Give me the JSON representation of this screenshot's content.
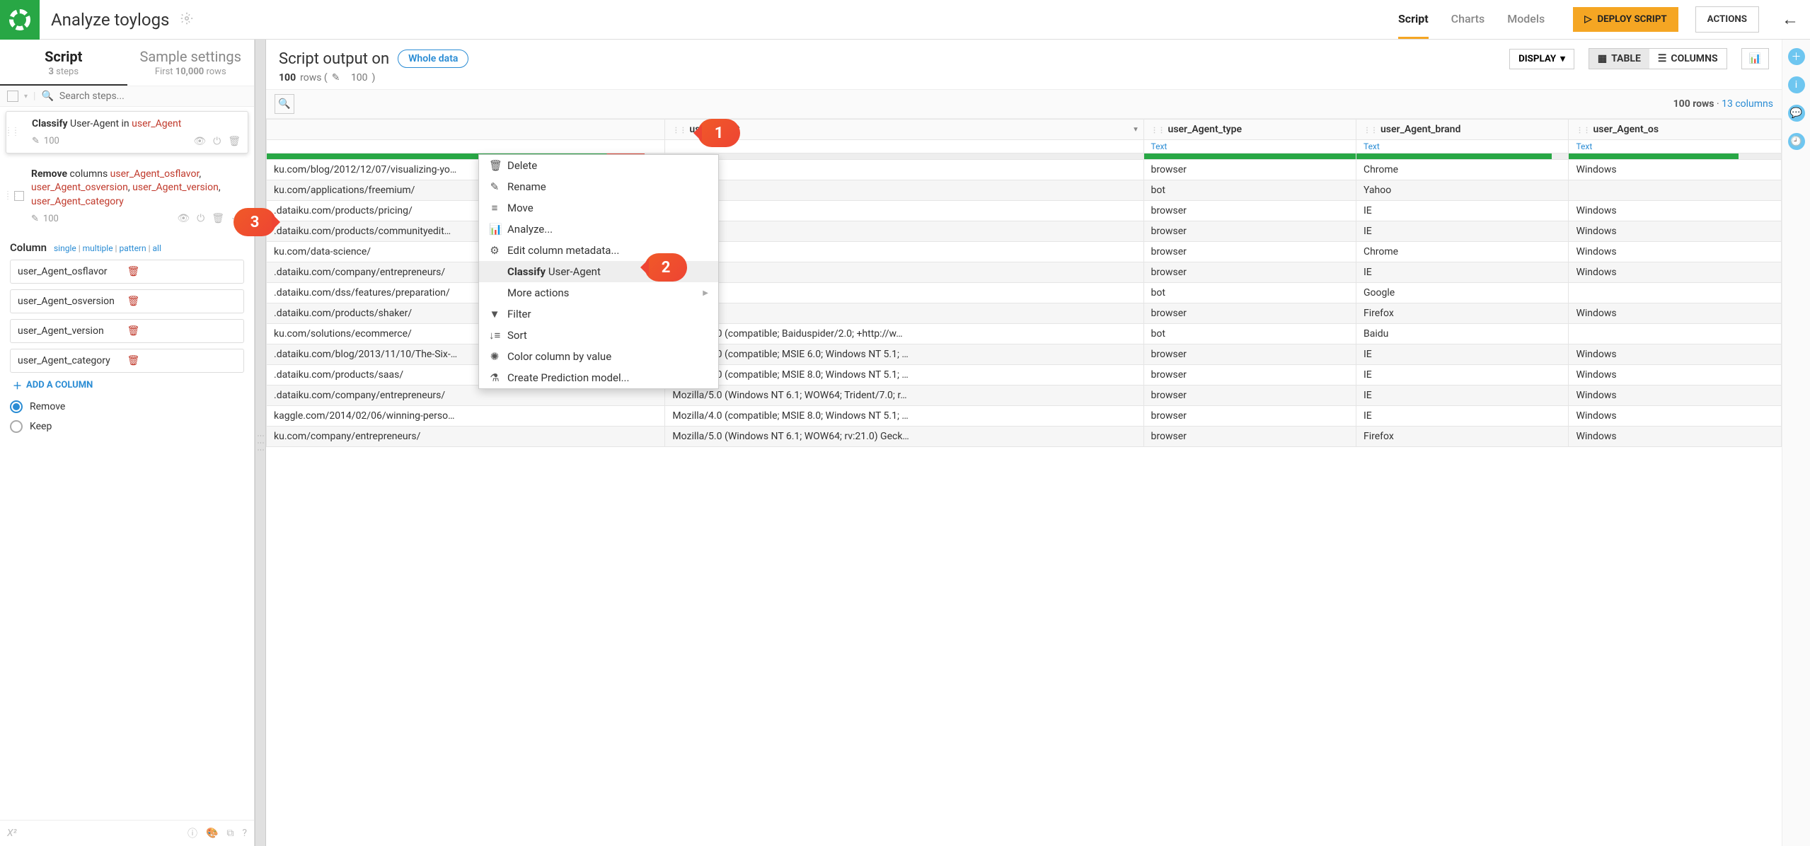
{
  "header": {
    "title": "Analyze toylogs",
    "tabs": [
      "Script",
      "Charts",
      "Models"
    ],
    "active_tab": 0,
    "deploy": "DEPLOY SCRIPT",
    "actions": "ACTIONS"
  },
  "left_panel": {
    "tabs": [
      {
        "title": "Script",
        "sub_pre": "3",
        "sub_post": " steps"
      },
      {
        "title": "Sample settings",
        "sub_pre": "First ",
        "sub_mid": "10,000",
        "sub_post": " rows"
      }
    ],
    "active_tab": 0,
    "search_placeholder": "Search steps...",
    "steps": [
      {
        "text_parts": [
          "Classify",
          " User-Agent in ",
          "user_Agent"
        ],
        "count": "100"
      },
      {
        "text_parts": [
          "Remove",
          " columns ",
          "user_Agent_osflavor",
          ", ",
          "user_Agent_osversion",
          ", ",
          "user_Agent_version",
          ", ",
          "user_Agent_category"
        ],
        "count": "100"
      }
    ],
    "params": {
      "label": "Column",
      "links": [
        "single",
        "multiple",
        "pattern",
        "all"
      ],
      "columns": [
        "user_Agent_osflavor",
        "user_Agent_osversion",
        "user_Agent_version",
        "user_Agent_category"
      ],
      "add": "ADD A COLUMN",
      "radios": [
        "Remove",
        "Keep"
      ],
      "radio_selected": 0
    }
  },
  "output": {
    "title": "Script output on",
    "whole_data": "Whole data",
    "rows_label_pre": "100",
    "rows_label_post": " rows  ( ",
    "rows_edit": "100",
    "rows_label_end": " )",
    "display": "DISPLAY",
    "table": "TABLE",
    "columns_btn": "COLUMNS",
    "info_rows": "100 rows",
    "info_cols": "13 columns",
    "table_cols": [
      {
        "name": "",
        "type": ""
      },
      {
        "name": "user_Agent",
        "type": ""
      },
      {
        "name": "user_Agent_type",
        "type": "Text"
      },
      {
        "name": "user_Agent_brand",
        "type": "Text"
      },
      {
        "name": "user_Agent_os",
        "type": "Text"
      }
    ],
    "bar_widths": [
      "95%",
      "0%",
      "100%",
      "92%",
      "80%"
    ],
    "rows": [
      [
        "ku.com/blog/2012/12/07/visualizing-yo…",
        "",
        "browser",
        "Chrome",
        "Windows"
      ],
      [
        "ku.com/applications/freemium/",
        "",
        "bot",
        "Yahoo",
        ""
      ],
      [
        ".dataiku.com/products/pricing/",
        "",
        "browser",
        "IE",
        "Windows"
      ],
      [
        ".dataiku.com/products/communityedit…",
        "",
        "browser",
        "IE",
        "Windows"
      ],
      [
        "ku.com/data-science/",
        "",
        "browser",
        "Chrome",
        "Windows"
      ],
      [
        ".dataiku.com/company/entrepreneurs/",
        "",
        "browser",
        "IE",
        "Windows"
      ],
      [
        ".dataiku.com/dss/features/preparation/",
        "",
        "bot",
        "Google",
        ""
      ],
      [
        ".dataiku.com/products/shaker/",
        "",
        "browser",
        "Firefox",
        "Windows"
      ],
      [
        "ku.com/solutions/ecommerce/",
        "Mozilla/5.0 (compatible; Baiduspider/2.0; +http://w…",
        "bot",
        "Baidu",
        ""
      ],
      [
        ".dataiku.com/blog/2013/11/10/The-Six-…",
        "Mozilla/4.0 (compatible; MSIE 6.0; Windows NT 5.1; …",
        "browser",
        "IE",
        "Windows"
      ],
      [
        ".dataiku.com/products/saas/",
        "Mozilla/4.0 (compatible; MSIE 8.0; Windows NT 5.1; …",
        "browser",
        "IE",
        "Windows"
      ],
      [
        ".dataiku.com/company/entrepreneurs/",
        "Mozilla/5.0 (Windows NT 6.1; WOW64; Trident/7.0; r…",
        "browser",
        "IE",
        "Windows"
      ],
      [
        "kaggle.com/2014/02/06/winning-perso…",
        "Mozilla/4.0 (compatible; MSIE 8.0; Windows NT 5.1; …",
        "browser",
        "IE",
        "Windows"
      ],
      [
        "ku.com/company/entrepreneurs/",
        "Mozilla/5.0 (Windows NT 6.1; WOW64; rv:21.0) Geck…",
        "browser",
        "Firefox",
        "Windows"
      ]
    ]
  },
  "ctx_menu": {
    "items": [
      {
        "icon": "🗑",
        "label": "Delete"
      },
      {
        "icon": "✎",
        "label": "Rename"
      },
      {
        "icon": "≡",
        "label": "Move"
      },
      {
        "icon": "📊",
        "label": "Analyze..."
      },
      {
        "icon": "⚙",
        "label": "Edit column metadata..."
      },
      {
        "icon": "",
        "label_pre": "Classify",
        "label_post": " User-Agent",
        "bold": true,
        "selected": true
      },
      {
        "icon": "",
        "label": "More actions",
        "arrow": true
      },
      {
        "icon": "▼",
        "label": "Filter",
        "funnel": true
      },
      {
        "icon": "↓≡",
        "label": "Sort"
      },
      {
        "icon": "✺",
        "label": "Color column by value"
      },
      {
        "icon": "⚗",
        "label": "Create Prediction model..."
      }
    ]
  },
  "callouts": {
    "c1": "1",
    "c2": "2",
    "c3": "3"
  }
}
